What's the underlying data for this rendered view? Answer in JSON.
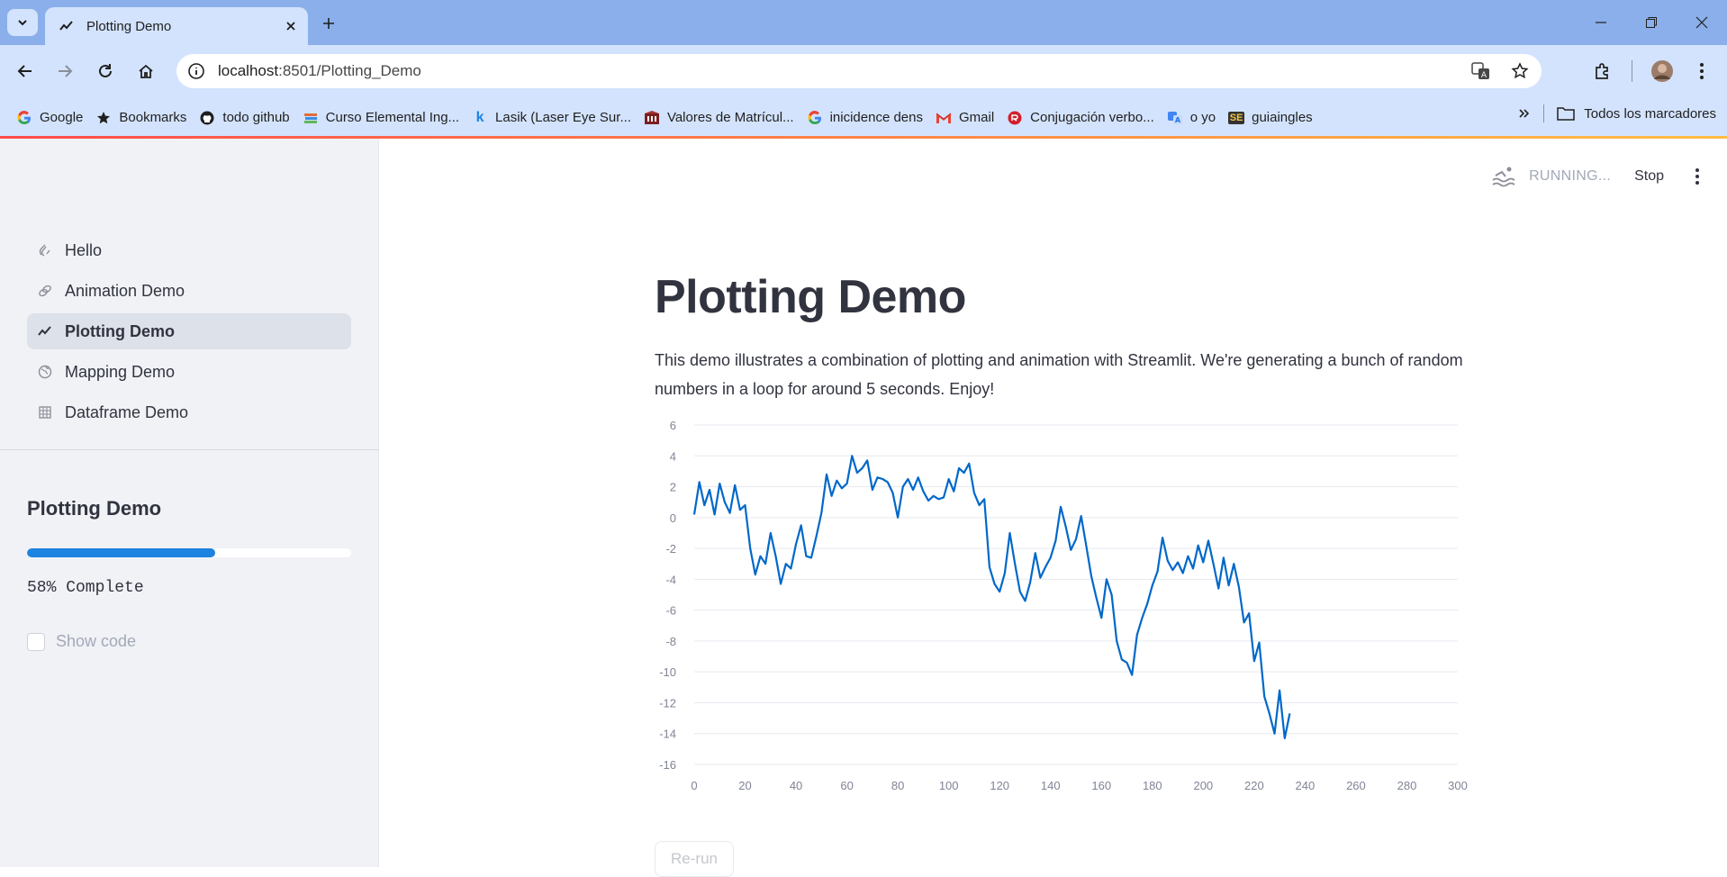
{
  "browser": {
    "tab_title": "Plotting Demo",
    "url_host": "localhost",
    "url_path": ":8501/Plotting_Demo",
    "bookmarks": [
      {
        "label": "Google",
        "icon": "google-icon"
      },
      {
        "label": "Bookmarks",
        "icon": "star-icon"
      },
      {
        "label": "todo github",
        "icon": "github-icon"
      },
      {
        "label": "Curso Elemental Ing...",
        "icon": "books-icon"
      },
      {
        "label": "Lasik (Laser Eye Sur...",
        "icon": "k-icon"
      },
      {
        "label": "Valores de Matrícul...",
        "icon": "building-icon"
      },
      {
        "label": "inicidence dens",
        "icon": "google-icon"
      },
      {
        "label": "Gmail",
        "icon": "gmail-icon"
      },
      {
        "label": "Conjugación verbo...",
        "icon": "reverso-icon"
      },
      {
        "label": "o yo",
        "icon": "translate-icon"
      },
      {
        "label": "guiaingles",
        "icon": "se-icon"
      }
    ],
    "all_bookmarks": "Todos los marcadores"
  },
  "sidebar": {
    "nav": [
      {
        "label": "Hello",
        "icon": "wave-icon",
        "active": false
      },
      {
        "label": "Animation Demo",
        "icon": "rings-icon",
        "active": false
      },
      {
        "label": "Plotting Demo",
        "icon": "chart-line-icon",
        "active": true
      },
      {
        "label": "Mapping Demo",
        "icon": "globe-icon",
        "active": false
      },
      {
        "label": "Dataframe Demo",
        "icon": "table-icon",
        "active": false
      }
    ],
    "title": "Plotting Demo",
    "progress": 0.58,
    "status_text": "58% Complete",
    "show_code_label": "Show code",
    "show_code_checked": false
  },
  "header": {
    "running_label": "RUNNING...",
    "stop_label": "Stop"
  },
  "main": {
    "title": "Plotting Demo",
    "description": "This demo illustrates a combination of plotting and animation with Streamlit. We're generating a bunch of random numbers in a loop for around 5 seconds. Enjoy!",
    "rerun_label": "Re-run"
  },
  "colors": {
    "line": "#0068c9",
    "progress": "#1c83e1",
    "sidebar_bg": "#f0f2f6",
    "tabstrip": "#8aafea"
  },
  "chart_data": {
    "type": "line",
    "title": "",
    "xlabel": "",
    "ylabel": "",
    "xlim": [
      0,
      300
    ],
    "ylim": [
      -16,
      6
    ],
    "xticks": [
      0,
      20,
      40,
      60,
      80,
      100,
      120,
      140,
      160,
      180,
      200,
      220,
      240,
      260,
      280,
      300
    ],
    "yticks": [
      6,
      4,
      2,
      0,
      -2,
      -4,
      -6,
      -8,
      -10,
      -12,
      -14,
      -16
    ],
    "grid": true,
    "x_step": 2,
    "series": [
      {
        "values": [
          0.2,
          2.3,
          0.8,
          1.8,
          0.2,
          2.2,
          1.0,
          0.3,
          2.1,
          0.5,
          0.8,
          -2.0,
          -3.7,
          -2.5,
          -3.0,
          -1.0,
          -2.5,
          -4.3,
          -3.0,
          -3.3,
          -1.7,
          -0.5,
          -2.5,
          -2.6,
          -1.2,
          0.3,
          2.8,
          1.4,
          2.4,
          1.9,
          2.2,
          4.0,
          2.9,
          3.2,
          3.7,
          1.8,
          2.6,
          2.5,
          2.3,
          1.6,
          0.0,
          2.0,
          2.5,
          1.8,
          2.6,
          1.7,
          1.1,
          1.4,
          1.2,
          1.3,
          2.5,
          1.7,
          3.2,
          2.9,
          3.5,
          1.6,
          0.8,
          1.2,
          -3.2,
          -4.3,
          -4.8,
          -3.6,
          -1.0,
          -3.0,
          -4.8,
          -5.4,
          -4.2,
          -2.3,
          -3.9,
          -3.2,
          -2.6,
          -1.5,
          0.7,
          -0.6,
          -2.1,
          -1.4,
          0.1,
          -1.8,
          -3.8,
          -5.2,
          -6.5,
          -4.0,
          -5.0,
          -8.0,
          -9.2,
          -9.4,
          -10.2,
          -7.6,
          -6.5,
          -5.6,
          -4.4,
          -3.5,
          -1.3,
          -2.8,
          -3.4,
          -2.9,
          -3.6,
          -2.5,
          -3.3,
          -1.8,
          -2.9,
          -1.5,
          -3.0,
          -4.6,
          -2.6,
          -4.4,
          -3.0,
          -4.5,
          -6.8,
          -6.2,
          -9.3,
          -8.1,
          -11.6,
          -12.7,
          -14.0,
          -11.2,
          -14.3,
          -12.7
        ]
      }
    ]
  }
}
